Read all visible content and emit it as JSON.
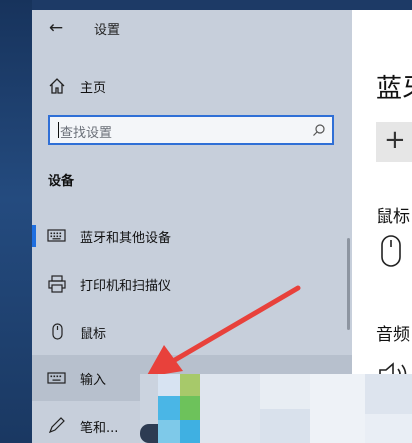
{
  "window": {
    "title": "设置"
  },
  "nav": {
    "home_label": "主页",
    "search_placeholder": "查找设置",
    "section_label": "设备",
    "items": [
      {
        "label": "蓝牙和其他设备",
        "icon": "keyboard-icon",
        "selected": true
      },
      {
        "label": "打印机和扫描仪",
        "icon": "printer-icon",
        "selected": false
      },
      {
        "label": "鼠标",
        "icon": "mouse-icon",
        "selected": false
      },
      {
        "label": "输入",
        "icon": "keyboard-icon",
        "selected": false,
        "hovered": true
      },
      {
        "label": "笔和...",
        "icon": "pen-icon",
        "selected": false
      }
    ]
  },
  "content": {
    "heading": "蓝牙",
    "add_button_symbol": "+",
    "subheading_1": "鼠标",
    "subheading_2": "音频"
  },
  "colors": {
    "accent": "#1f6fe0",
    "arrow": "#e8413b",
    "pane_bg": "#c7cfdb"
  }
}
